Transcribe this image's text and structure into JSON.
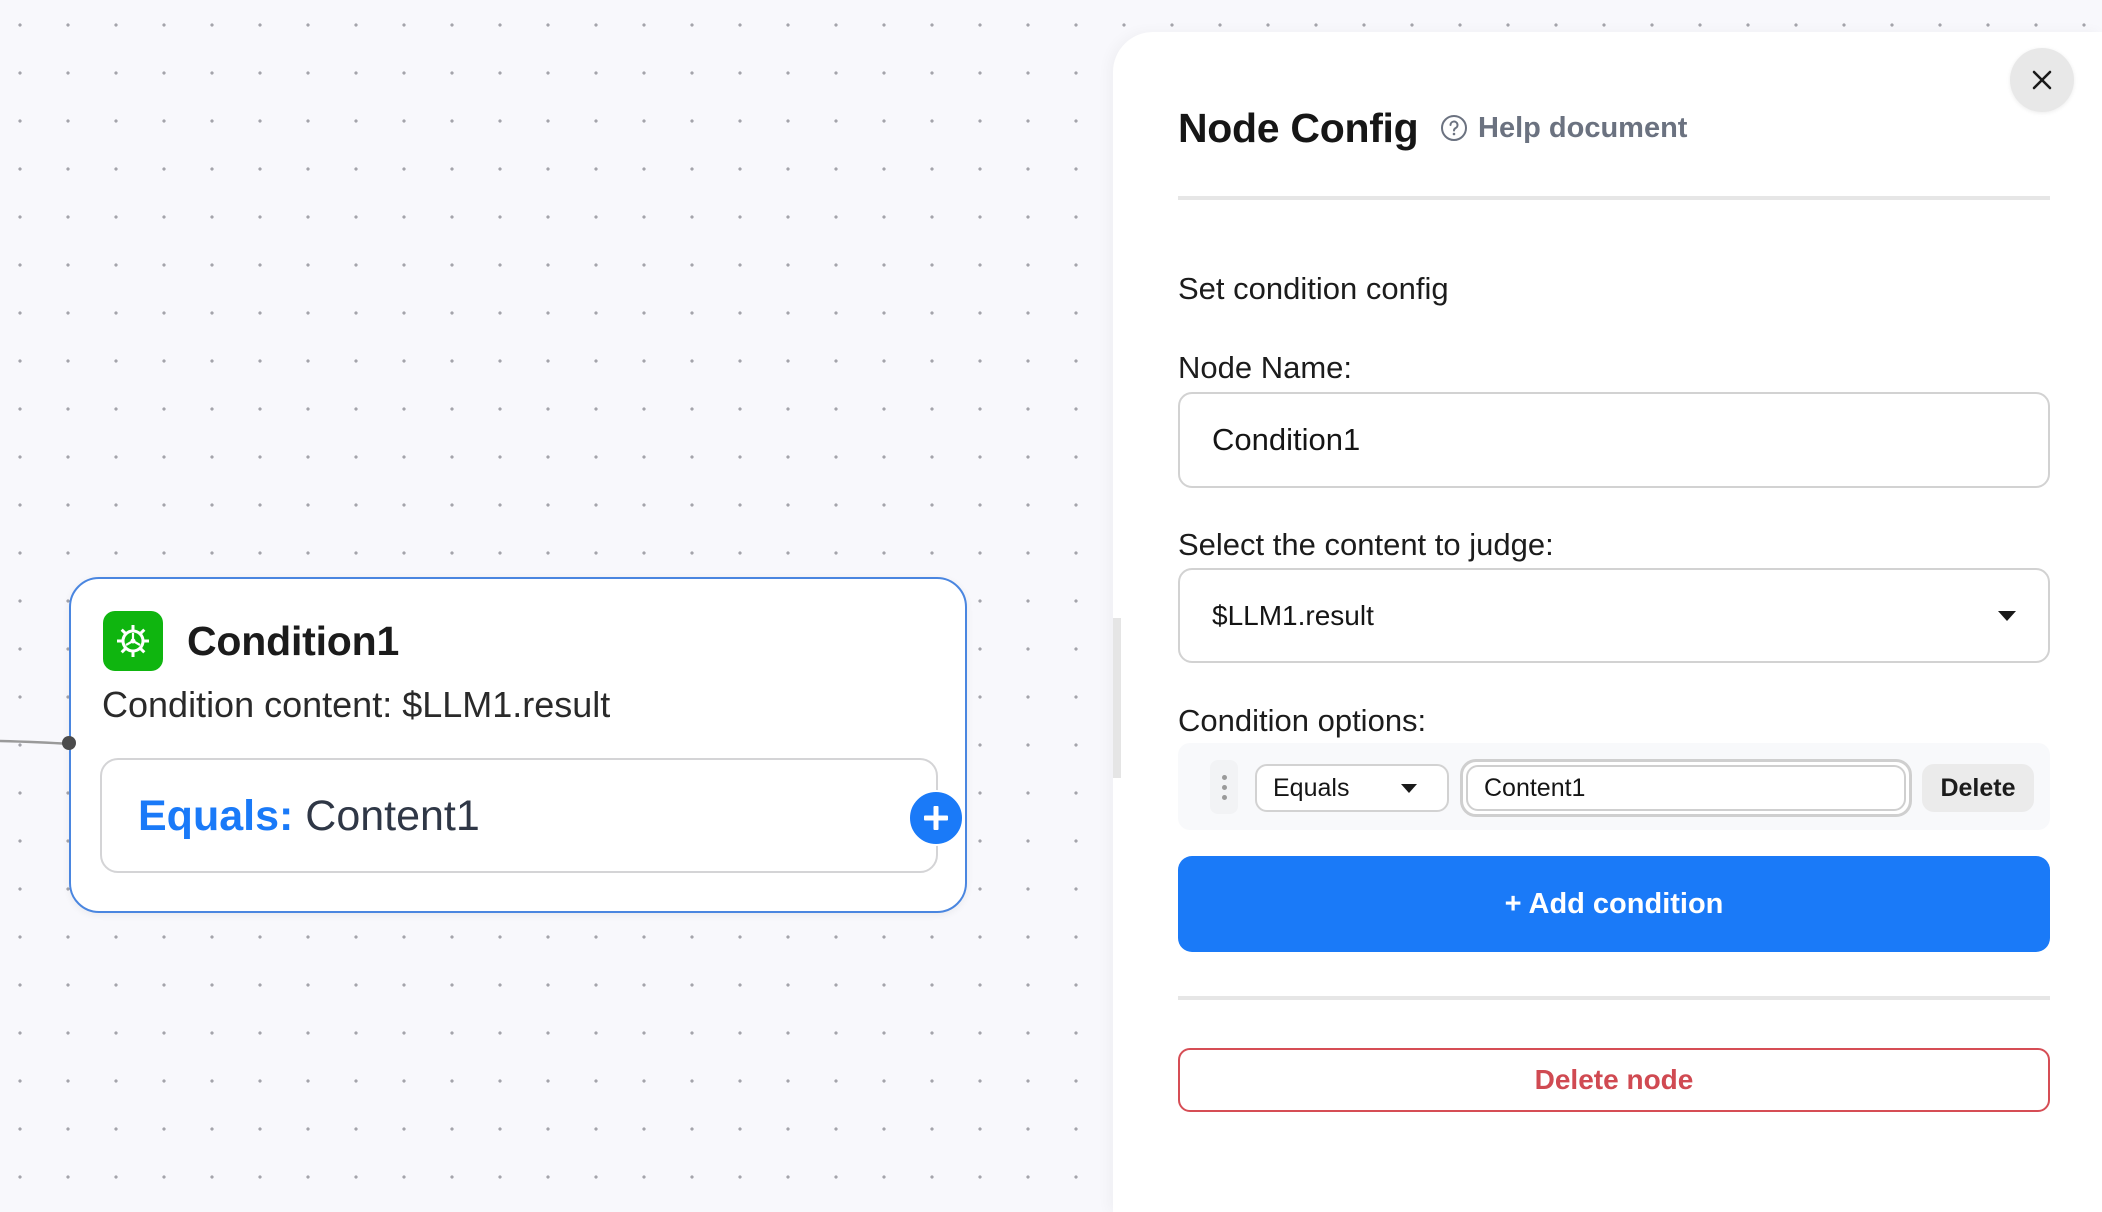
{
  "canvas": {
    "node": {
      "title": "Condition1",
      "icon": "condition-gear-icon",
      "description": "Condition content: $LLM1.result",
      "condition": {
        "operator_label": "Equals:",
        "value": "Content1"
      },
      "add_branch_icon": "plus-icon",
      "colors": {
        "border": "#4a86e0",
        "icon_bg": "#0fb50f",
        "operator": "#1a7af8"
      }
    }
  },
  "panel": {
    "title": "Node Config",
    "help_link": "Help document",
    "help_icon": "question-circle-icon",
    "close_icon": "close-icon",
    "section_title": "Set condition config",
    "node_name": {
      "label": "Node Name:",
      "value": "Condition1"
    },
    "content_select": {
      "label": "Select the content to judge:",
      "value": "$LLM1.result"
    },
    "conditions": {
      "label": "Condition options:",
      "items": [
        {
          "operator": "Equals",
          "value": "Content1",
          "delete_label": "Delete"
        }
      ]
    },
    "add_condition_label": "+ Add condition",
    "delete_node_label": "Delete node",
    "colors": {
      "primary": "#1a7af8",
      "danger": "#d04a52"
    }
  }
}
